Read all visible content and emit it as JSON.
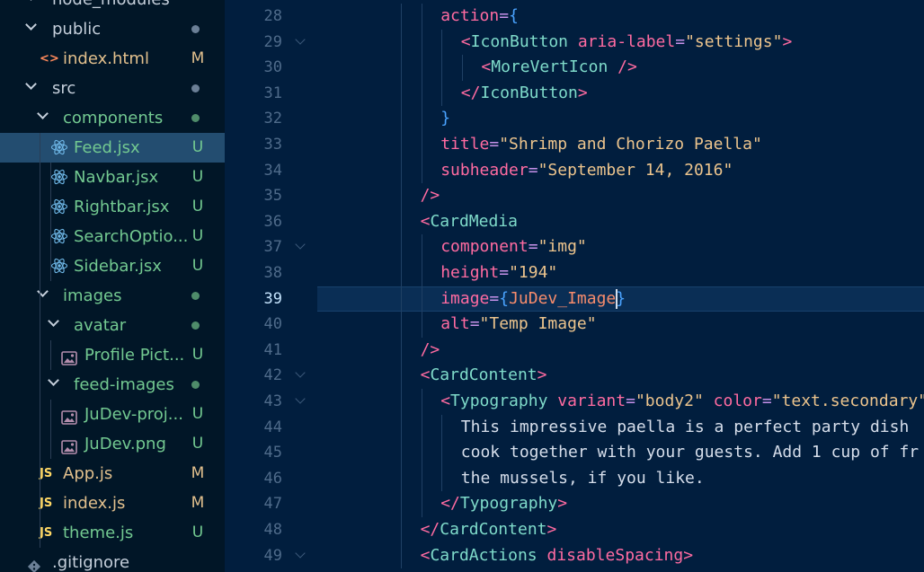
{
  "explorer": {
    "items": [
      {
        "name": "node_modules",
        "kind": "folder",
        "expanded": false,
        "depth": 0,
        "status": "",
        "color": "#c5cfdb"
      },
      {
        "name": "public",
        "kind": "folder",
        "expanded": true,
        "depth": 0,
        "status": "dot",
        "color": "#c5cfdb"
      },
      {
        "name": "index.html",
        "kind": "html",
        "depth": 1,
        "status": "M",
        "color": "#e2c08d"
      },
      {
        "name": "src",
        "kind": "folder",
        "expanded": true,
        "depth": 0,
        "status": "dot",
        "color": "#c5cfdb"
      },
      {
        "name": "components",
        "kind": "folder",
        "expanded": true,
        "depth": 1,
        "status": "dot-green",
        "color": "#73c991"
      },
      {
        "name": "Feed.jsx",
        "kind": "react",
        "depth": 2,
        "status": "U",
        "color": "#73c991",
        "selected": true
      },
      {
        "name": "Navbar.jsx",
        "kind": "react",
        "depth": 2,
        "status": "U",
        "color": "#73c991"
      },
      {
        "name": "Rightbar.jsx",
        "kind": "react",
        "depth": 2,
        "status": "U",
        "color": "#73c991"
      },
      {
        "name": "SearchOptio...",
        "kind": "react",
        "depth": 2,
        "status": "U",
        "color": "#73c991"
      },
      {
        "name": "Sidebar.jsx",
        "kind": "react",
        "depth": 2,
        "status": "U",
        "color": "#73c991"
      },
      {
        "name": "images",
        "kind": "folder",
        "expanded": true,
        "depth": 1,
        "status": "dot-green",
        "color": "#73c991"
      },
      {
        "name": "avatar",
        "kind": "folder",
        "expanded": true,
        "depth": 2,
        "status": "dot-green",
        "color": "#73c991"
      },
      {
        "name": "Profile Pict...",
        "kind": "image",
        "depth": 3,
        "status": "U",
        "color": "#73c991"
      },
      {
        "name": "feed-images",
        "kind": "folder",
        "expanded": true,
        "depth": 2,
        "status": "dot-green",
        "color": "#73c991"
      },
      {
        "name": "JuDev-proj...",
        "kind": "image",
        "depth": 3,
        "status": "U",
        "color": "#73c991"
      },
      {
        "name": "JuDev.png",
        "kind": "image",
        "depth": 3,
        "status": "U",
        "color": "#73c991"
      },
      {
        "name": "App.js",
        "kind": "js",
        "depth": 1,
        "status": "M",
        "color": "#e2c08d"
      },
      {
        "name": "index.js",
        "kind": "js",
        "depth": 1,
        "status": "M",
        "color": "#e2c08d"
      },
      {
        "name": "theme.js",
        "kind": "js",
        "depth": 1,
        "status": "U",
        "color": "#73c991"
      },
      {
        "name": ".gitignore",
        "kind": "git",
        "depth": 0,
        "status": "",
        "color": "#c5cfdb"
      }
    ]
  },
  "editor": {
    "current_line": 39,
    "lines": [
      {
        "n": 28,
        "indent": 2,
        "tokens": [
          [
            "t-attr",
            "action"
          ],
          [
            "t-eq",
            "="
          ],
          [
            "t-brace",
            "{"
          ]
        ]
      },
      {
        "n": 29,
        "indent": 3,
        "fold": true,
        "tokens": [
          [
            "t-br",
            "<"
          ],
          [
            "t-tag",
            "IconButton"
          ],
          [
            "t-txt",
            " "
          ],
          [
            "t-attr",
            "aria-label"
          ],
          [
            "t-eq",
            "="
          ],
          [
            "t-str",
            "\"settings\""
          ],
          [
            "t-br",
            ">"
          ]
        ]
      },
      {
        "n": 30,
        "indent": 4,
        "tokens": [
          [
            "t-br",
            "<"
          ],
          [
            "t-tag",
            "MoreVertIcon"
          ],
          [
            "t-txt",
            " "
          ],
          [
            "t-br",
            "/>"
          ]
        ]
      },
      {
        "n": 31,
        "indent": 3,
        "tokens": [
          [
            "t-br",
            "</"
          ],
          [
            "t-tag",
            "IconButton"
          ],
          [
            "t-br",
            ">"
          ]
        ]
      },
      {
        "n": 32,
        "indent": 2,
        "tokens": [
          [
            "t-brace",
            "}"
          ]
        ]
      },
      {
        "n": 33,
        "indent": 2,
        "tokens": [
          [
            "t-attr",
            "title"
          ],
          [
            "t-eq",
            "="
          ],
          [
            "t-str",
            "\"Shrimp and Chorizo Paella\""
          ]
        ]
      },
      {
        "n": 34,
        "indent": 2,
        "tokens": [
          [
            "t-attr",
            "subheader"
          ],
          [
            "t-eq",
            "="
          ],
          [
            "t-str",
            "\"September 14, 2016\""
          ]
        ]
      },
      {
        "n": 35,
        "indent": 1,
        "tokens": [
          [
            "t-br",
            "/>"
          ]
        ]
      },
      {
        "n": 36,
        "indent": 1,
        "tokens": [
          [
            "t-br",
            "<"
          ],
          [
            "t-tag",
            "CardMedia"
          ]
        ]
      },
      {
        "n": 37,
        "indent": 2,
        "fold": true,
        "tokens": [
          [
            "t-attr",
            "component"
          ],
          [
            "t-eq",
            "="
          ],
          [
            "t-str",
            "\"img\""
          ]
        ]
      },
      {
        "n": 38,
        "indent": 2,
        "tokens": [
          [
            "t-attr",
            "height"
          ],
          [
            "t-eq",
            "="
          ],
          [
            "t-str",
            "\"194\""
          ]
        ]
      },
      {
        "n": 39,
        "indent": 2,
        "tokens": [
          [
            "t-attr",
            "image"
          ],
          [
            "t-eq",
            "="
          ],
          [
            "t-brace",
            "{"
          ],
          [
            "t-var",
            "JuDev_Image"
          ],
          [
            "t-brace",
            "}"
          ]
        ]
      },
      {
        "n": 40,
        "indent": 2,
        "tokens": [
          [
            "t-attr",
            "alt"
          ],
          [
            "t-eq",
            "="
          ],
          [
            "t-str",
            "\"Temp Image\""
          ]
        ]
      },
      {
        "n": 41,
        "indent": 1,
        "tokens": [
          [
            "t-br",
            "/>"
          ]
        ]
      },
      {
        "n": 42,
        "indent": 1,
        "fold": true,
        "tokens": [
          [
            "t-br",
            "<"
          ],
          [
            "t-tag",
            "CardContent"
          ],
          [
            "t-br",
            ">"
          ]
        ]
      },
      {
        "n": 43,
        "indent": 2,
        "fold": true,
        "tokens": [
          [
            "t-br",
            "<"
          ],
          [
            "t-tag",
            "Typography"
          ],
          [
            "t-txt",
            " "
          ],
          [
            "t-attr",
            "variant"
          ],
          [
            "t-eq",
            "="
          ],
          [
            "t-str",
            "\"body2\""
          ],
          [
            "t-txt",
            " "
          ],
          [
            "t-attr",
            "color"
          ],
          [
            "t-eq",
            "="
          ],
          [
            "t-str",
            "\"text.secondary\""
          ]
        ]
      },
      {
        "n": 44,
        "indent": 3,
        "tokens": [
          [
            "t-txt",
            "This impressive paella is a perfect party dish"
          ]
        ]
      },
      {
        "n": 45,
        "indent": 3,
        "tokens": [
          [
            "t-txt",
            "cook together with your guests. Add 1 cup of fr"
          ]
        ]
      },
      {
        "n": 46,
        "indent": 3,
        "tokens": [
          [
            "t-txt",
            "the mussels, if you like."
          ]
        ]
      },
      {
        "n": 47,
        "indent": 2,
        "tokens": [
          [
            "t-br",
            "</"
          ],
          [
            "t-tag",
            "Typography"
          ],
          [
            "t-br",
            ">"
          ]
        ]
      },
      {
        "n": 48,
        "indent": 1,
        "tokens": [
          [
            "t-br",
            "</"
          ],
          [
            "t-tag",
            "CardContent"
          ],
          [
            "t-br",
            ">"
          ]
        ]
      },
      {
        "n": 49,
        "indent": 1,
        "fold": true,
        "tokens": [
          [
            "t-br",
            "<"
          ],
          [
            "t-tag",
            "CardActions"
          ],
          [
            "t-txt",
            " "
          ],
          [
            "t-attr",
            "disableSpacing"
          ],
          [
            "t-br",
            ">"
          ]
        ]
      }
    ]
  }
}
